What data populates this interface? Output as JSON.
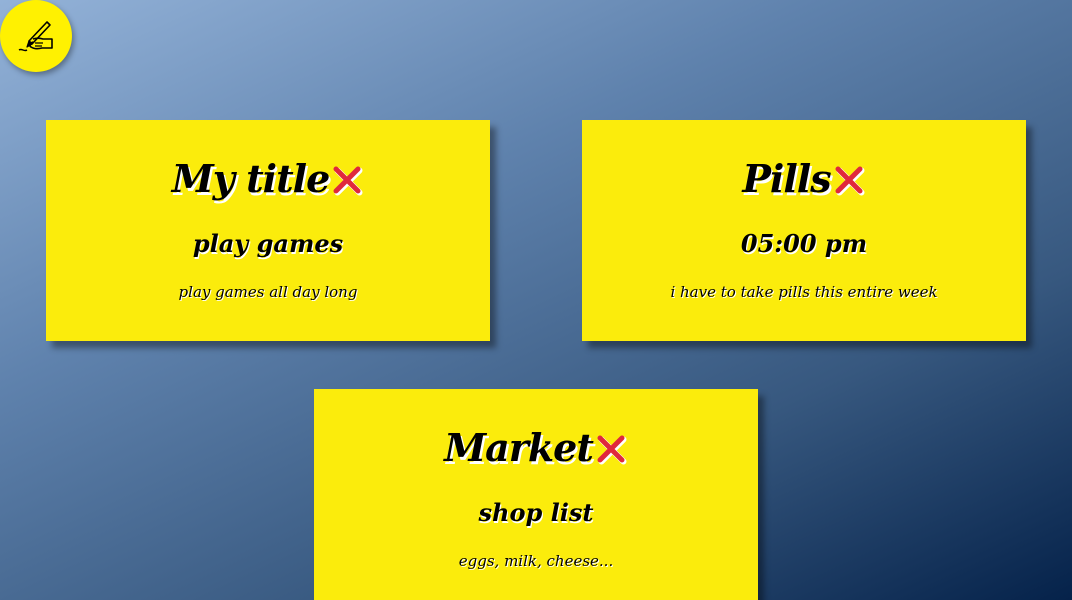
{
  "add_button": {
    "icon": "writing-hand-icon",
    "color": "#fff101"
  },
  "colors": {
    "note_background": "#fbec0c",
    "delete_icon": "#e0283c"
  },
  "notes": [
    {
      "title": "My title",
      "subtitle": "play games",
      "body": "play games all day long",
      "delete_icon": "cross-mark-icon"
    },
    {
      "title": "Pills",
      "subtitle": "05:00 pm",
      "body": "i have to take pills this entire week",
      "delete_icon": "cross-mark-icon"
    },
    {
      "title": "Market",
      "subtitle": "shop list",
      "body": "eggs, milk, cheese...",
      "delete_icon": "cross-mark-icon"
    }
  ]
}
